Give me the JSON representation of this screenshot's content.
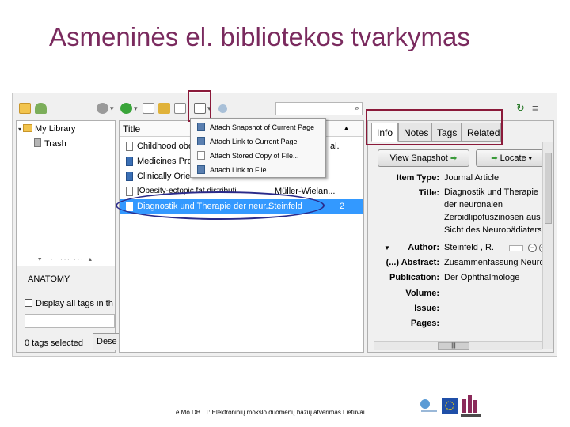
{
  "slide": {
    "title": "Asmeninės el. bibliotekos tvarkymas",
    "footer": "e.Mo.DB.LT: Elektroninių mokslo duomenų bazių atvėrimas Lietuvai"
  },
  "colors": {
    "title": "#7a2a5e",
    "annotation_rect": "#8b1a3a",
    "annotation_oval": "#2a2a8a",
    "selection": "#3399ff"
  },
  "toolbar": {
    "icons": [
      "new-collection-icon",
      "new-group-icon",
      "actions-gear-icon",
      "new-item-icon",
      "new-note-icon",
      "add-by-identifier-icon",
      "attach-icon",
      "advanced-search-icon"
    ],
    "search_placeholder": ""
  },
  "left_pane": {
    "library_label": "My Library",
    "trash_label": "Trash",
    "tag": "ANATOMY",
    "display_all_tags_label": "Display all tags in th",
    "tags_selected": "0 tags selected",
    "deselect_button": "Dese"
  },
  "middle_pane": {
    "column_title": "Title",
    "rows": [
      {
        "title": "Childhood obe",
        "extra": "al.",
        "type": "document"
      },
      {
        "title": "Medicines Pro",
        "extra": "",
        "type": "book"
      },
      {
        "title": "Clinically Orie",
        "extra": "",
        "type": "book"
      },
      {
        "title": "[Obesity-ectopic fat distributi...",
        "extra": "Müller-Wielan...",
        "type": "document"
      },
      {
        "title": "Diagnostik und Therapie der neur...",
        "extra": "Steinfeld",
        "count": "2",
        "type": "document",
        "selected": true
      }
    ]
  },
  "attach_menu": {
    "items": [
      "Attach Snapshot of Current Page",
      "Attach Link to Current Page",
      "Attach Stored Copy of File...",
      "Attach Link to File..."
    ]
  },
  "right_pane": {
    "tabs": [
      "Info",
      "Notes",
      "Tags",
      "Related"
    ],
    "active_tab": "Info",
    "view_snapshot_button": "View Snapshot",
    "locate_button": "Locate",
    "fields": {
      "item_type_label": "Item Type:",
      "item_type_value": "Journal Article",
      "title_label": "Title:",
      "title_lines": [
        "Diagnostik und Therapie",
        "der neuronalen",
        "Zeroidlipofuszinosen aus",
        "Sicht des Neuropädiaters"
      ],
      "author_label": "Author:",
      "author_value": "Steinfeld , R.",
      "abstract_label": "(...) Abstract:",
      "abstract_value": "Zusammenfassung  Neuro...",
      "publication_label": "Publication:",
      "publication_value": "Der Ophthalmologe",
      "volume_label": "Volume:",
      "issue_label": "Issue:",
      "pages_label": "Pages:"
    }
  }
}
